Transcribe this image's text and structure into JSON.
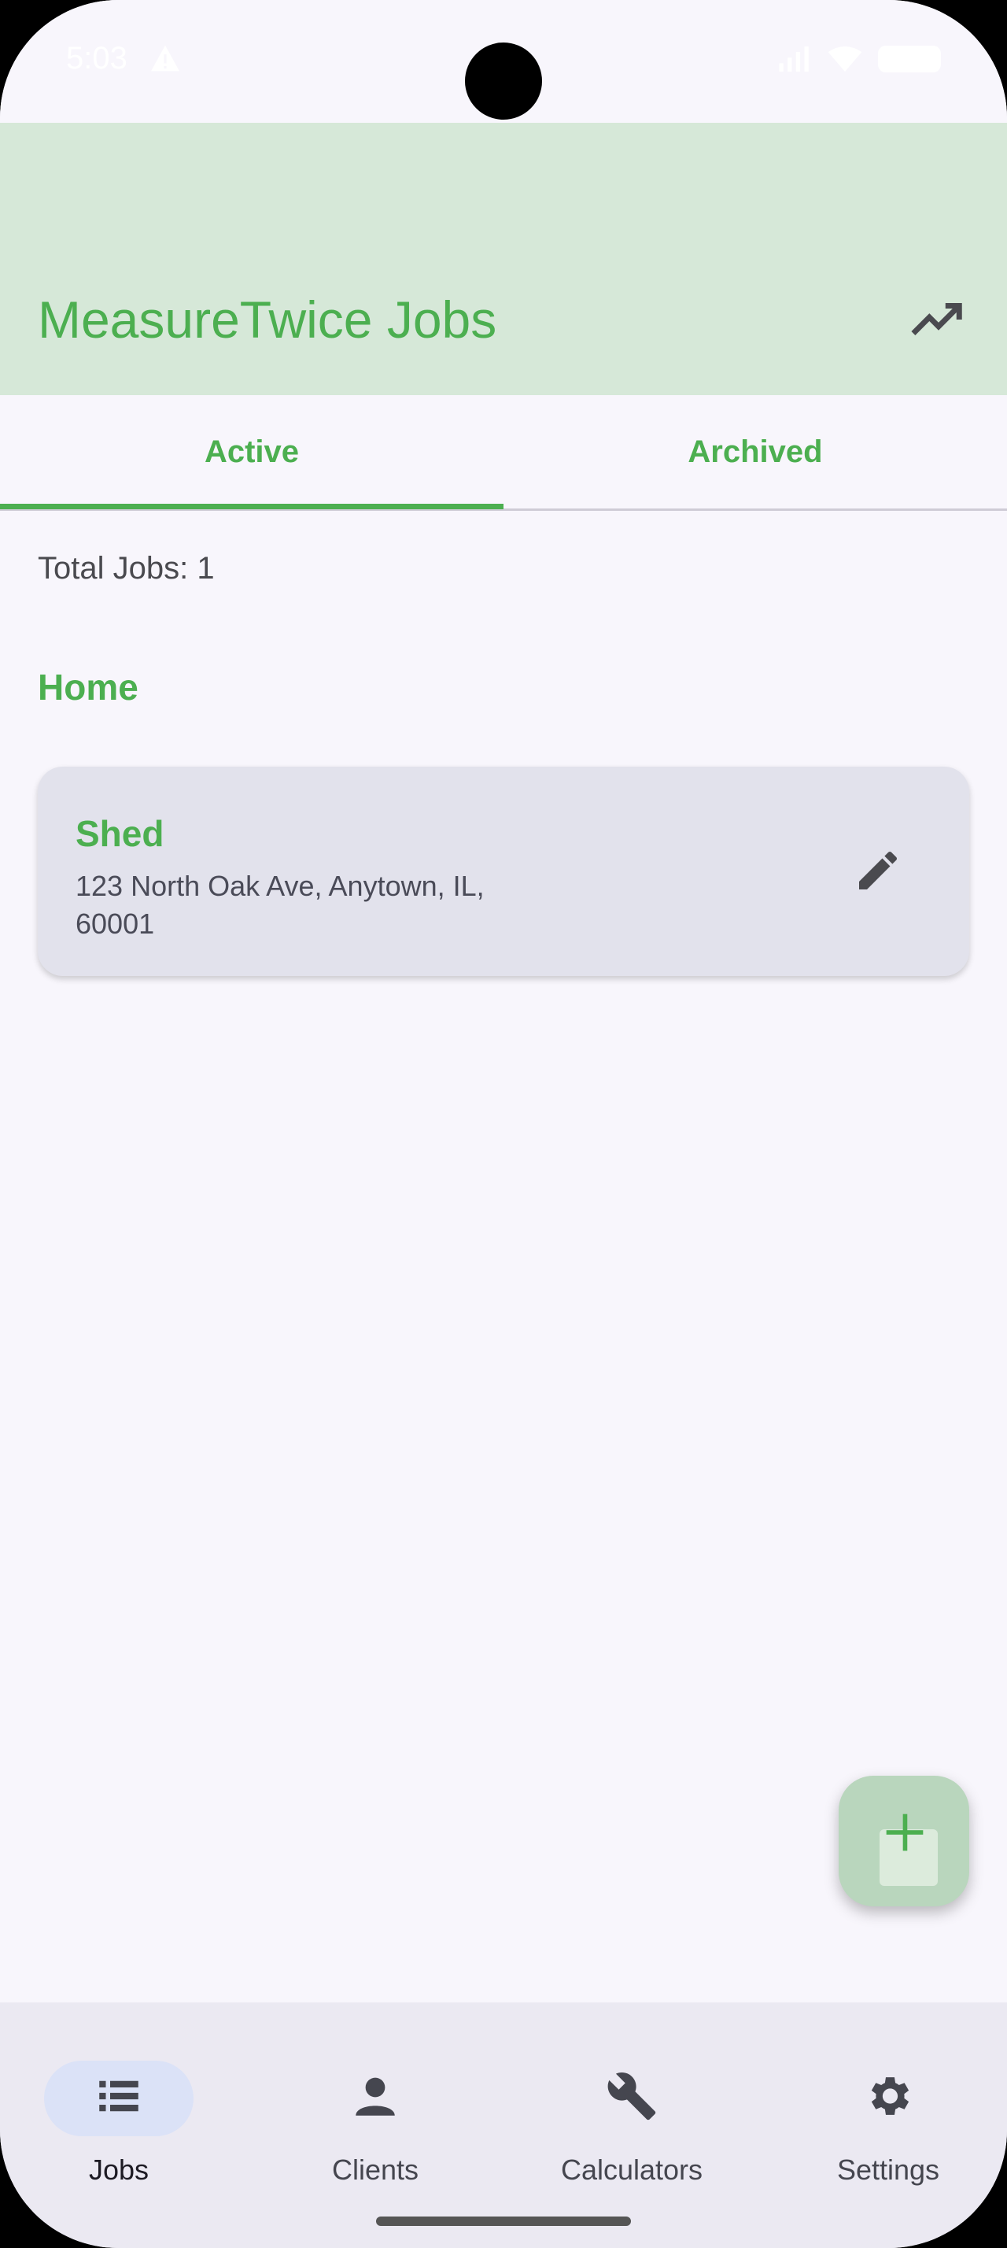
{
  "status": {
    "time": "5:03"
  },
  "app_bar": {
    "title": "MeasureTwice Jobs",
    "action_icon": "trending-up-icon"
  },
  "tabs": [
    {
      "label": "Active",
      "selected": true
    },
    {
      "label": "Archived",
      "selected": false
    }
  ],
  "summary": {
    "total_jobs": "Total Jobs: 1"
  },
  "groups": [
    {
      "title": "Home",
      "jobs": [
        {
          "name": "Shed",
          "address": "123 North Oak Ave, Anytown, IL, 60001"
        }
      ]
    }
  ],
  "fab": {
    "icon": "plus-icon"
  },
  "bottom_nav": [
    {
      "label": "Jobs",
      "icon": "list-icon",
      "selected": true
    },
    {
      "label": "Clients",
      "icon": "person-icon",
      "selected": false
    },
    {
      "label": "Calculators",
      "icon": "wrench-icon",
      "selected": false
    },
    {
      "label": "Settings",
      "icon": "gear-icon",
      "selected": false
    }
  ],
  "colors": {
    "accent": "#4caf50",
    "app_bar_bg": "#d6e8d8",
    "background": "#f8f6fc",
    "card_bg": "#e2e2ec",
    "nav_bg": "#ebe9f2",
    "nav_pill": "#dbe2f7"
  }
}
